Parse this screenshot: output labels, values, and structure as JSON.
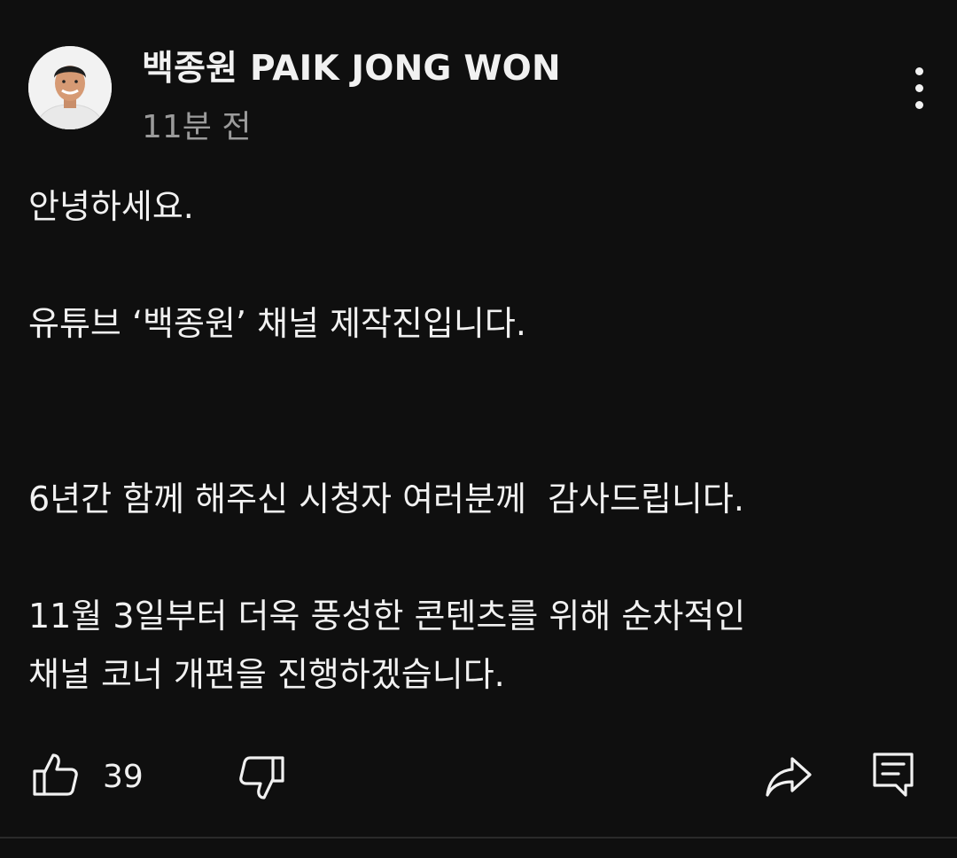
{
  "post": {
    "channel_name": "백종원 PAIK JONG WON",
    "timestamp": "11분 전",
    "body_lines": [
      "안녕하세요.",
      "",
      "유튜브 ‘백종원’ 채널 제작진입니다.",
      "",
      "",
      "6년간 함께 해주신 시청자 여러분께  감사드립니다.",
      "",
      "11월 3일부터 더욱 풍성한 콘텐츠를 위해 순차적인",
      "채널 코너 개편을 진행하겠습니다."
    ]
  },
  "actions": {
    "like_count": "39",
    "icons": [
      "thumbs-up-icon",
      "thumbs-down-icon",
      "share-icon",
      "comment-icon"
    ]
  },
  "colors": {
    "background": "#0f0f0f",
    "text": "#f1f1f1",
    "secondary_text": "#9b9b9b"
  }
}
